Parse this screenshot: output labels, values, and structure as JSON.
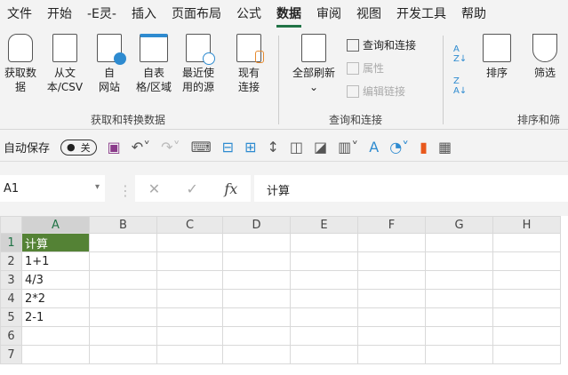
{
  "tabs": [
    "文件",
    "开始",
    "-E灵-",
    "插入",
    "页面布局",
    "公式",
    "数据",
    "审阅",
    "视图",
    "开发工具",
    "帮助"
  ],
  "active_tab": "数据",
  "ribbon": {
    "get_data": "获取数",
    "get_data2": "据",
    "from_text": "从文",
    "from_text2": "本/CSV",
    "from_web": "自",
    "from_web2": "网站",
    "from_table": "自表",
    "from_table2": "格/区域",
    "recent": "最近使",
    "recent2": "用的源",
    "existing": "现有",
    "existing2": "连接",
    "group1": "获取和转换数据",
    "refresh_all": "全部刷新",
    "queries": "查询和连接",
    "properties": "属性",
    "edit_links": "编辑链接",
    "group2": "查询和连接",
    "sort": "排序",
    "filter": "筛选",
    "group3": "排序和筛"
  },
  "qat": {
    "autosave": "自动保存",
    "toggle": "关"
  },
  "formula": {
    "namebox": "A1",
    "content": "计算"
  },
  "grid": {
    "columns": [
      "A",
      "B",
      "C",
      "D",
      "E",
      "F",
      "G",
      "H"
    ],
    "rows": [
      [
        "1",
        "计算"
      ],
      [
        "2",
        "1+1"
      ],
      [
        "3",
        "4/3"
      ],
      [
        "4",
        "2*2"
      ],
      [
        "5",
        "2-1"
      ],
      [
        "6",
        ""
      ],
      [
        "7",
        ""
      ]
    ]
  }
}
